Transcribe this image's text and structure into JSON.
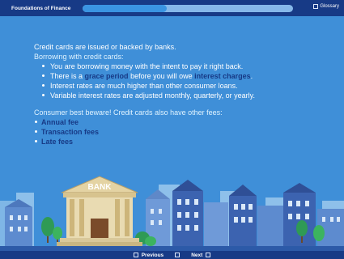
{
  "header": {
    "app_title": "Foundations of Finance",
    "progress_percent": 40,
    "glossary_label": "Glossary"
  },
  "content": {
    "intro": "Credit cards are issued or backed by banks.",
    "subheading": "Borrowing with credit cards:",
    "bullets": [
      "You are borrowing money with the intent to pay it right back.",
      {
        "before": "There is a ",
        "term1": "grace period",
        "middle": " before you will owe ",
        "term2": "interest charges",
        "after": "."
      },
      "Interest rates are much higher than other consumer loans.",
      "Variable interest rates are adjusted monthly, quarterly, or yearly."
    ],
    "fees_heading": "Consumer best beware! Credit cards also have other fees:",
    "fees": [
      "Annual fee",
      "Transaction fees",
      "Late fees"
    ]
  },
  "illustration": {
    "bank_sign": "BANK"
  },
  "footer": {
    "previous_label": "Previous",
    "next_label": "Next"
  },
  "colors": {
    "background": "#3f8fd8",
    "navy": "#173a86",
    "accent_text": "#dff3ff"
  }
}
